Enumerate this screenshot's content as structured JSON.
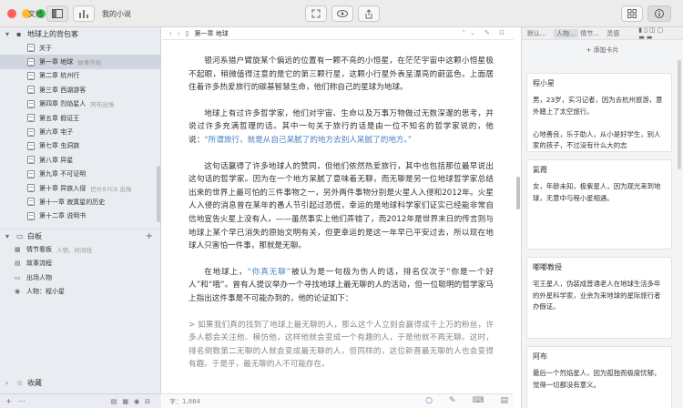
{
  "titlebar": {
    "sidebar_toggle_label": "文档",
    "project_name": "我的小说"
  },
  "sidebar": {
    "header": "地球上的背包客",
    "items": [
      {
        "label": "关于",
        "sub": ""
      },
      {
        "label": "第一章 地球",
        "sub": "故事开始"
      },
      {
        "label": "第二章 杭州行",
        "sub": ""
      },
      {
        "label": "第三章 西湖游客",
        "sub": ""
      },
      {
        "label": "第四章 烈焰星人",
        "sub": "阿布出场"
      },
      {
        "label": "第五章 假证王",
        "sub": ""
      },
      {
        "label": "第六章 宅子",
        "sub": ""
      },
      {
        "label": "第七章 虫洞族",
        "sub": ""
      },
      {
        "label": "第八章 异星",
        "sub": ""
      },
      {
        "label": "第九章 不可证明",
        "sub": ""
      },
      {
        "label": "第十章 异族入侵",
        "sub": "巴什97C6 出场"
      },
      {
        "label": "第十一章 寂寞星的历史",
        "sub": ""
      },
      {
        "label": "第十二章 说明书",
        "sub": ""
      }
    ],
    "board": {
      "header": "白板",
      "items": [
        {
          "label": "情节看板",
          "sub": "人物、时间线"
        },
        {
          "label": "故事流程",
          "sub": ""
        },
        {
          "label": "出场人物",
          "sub": ""
        },
        {
          "label": "人物：程小星",
          "sub": ""
        }
      ]
    },
    "favorites": "收藏"
  },
  "editor": {
    "title": "第一章 地球",
    "paragraphs": [
      {
        "pre": "银河系猎户臂旋某个偏远的位置有一颗不亮的小恒星，在茫茫宇宙中这颗小恒星极不起眼，稍微值得注意的是它的第三颗行星，这颗小行星外表呈漂亮的蔚蓝色，上面居住着许多热爱旅行的碳基智慧生命，他们称自己的星球为地球。",
        "hl": "",
        "post": ""
      },
      {
        "pre": "地球上有过许多哲学家，他们对宇宙、生命以及万事万物做过无数深邃的思考，并说过许多充满哲理的话。其中一句关于旅行的话是由一位不知名的哲学家说的，他说：",
        "hl": "“所谓旅行，就是从自己呆腻了的地方去别人呆腻了的地方。”",
        "post": ""
      },
      {
        "pre": "这句话赢得了许多地球人的赞同，但他们依然热爱旅行，其中也包括那位最早说出这句话的哲学家。因为在一个地方呆腻了意味着无聊，而无聊是另一位地球哲学家总结出来的世界上最可怕的三件事物之一，另外两件事物分别是火星人入侵和2012年。火星人入侵的消息曾在某年的愚人节引起过恐慌，幸运的是地球科学家们证实已经能非常自信地宣告火星上没有人，——虽然事实上他们弄错了，而2012年是世界末日的传言则与地球上某个早已消失的原始文明有关，但更幸运的是这一年早已平安过去，所以现在地球人只害怕一件事，那就是无聊。",
        "hl": "",
        "post": ""
      },
      {
        "pre": "在地球上，",
        "hl": "“你真无聊”",
        "post": "被认为是一句极为伤人的话，排名仅次于“你是一个好人”和“哦”。曾有人提议举办一个寻找地球上最无聊的人的活动，但一位聪明的哲学家马上指出这件事是不可能办到的，他的论证如下："
      }
    ],
    "quote": "> 如果我们真的找到了地球上最无聊的人，那么这个人立刻会赢得成千上万的粉丝，许多人都会关注他、模仿他，这样他就会变成一个有趣的人，于是他就不再无聊。这时，排名倒数第二无聊的人就会变成最无聊的人，但同样的，这位新晋最无聊的人也会变得有趣。于是乎，最无聊的人不可能存在。",
    "word_count": "字：1,884"
  },
  "rpanel": {
    "tabs": [
      "默认...",
      "人物...",
      "情节...",
      "灵感"
    ],
    "add_card": "+ 添加卡片",
    "cards": [
      {
        "title": "程小星",
        "body": "男，23岁，实习记者，因为去杭州旅游，意外踏上了太空旅行。\n\n心地善良，乐于助人，从小是好学生，别人家的孩子，不过没有什么大的志"
      },
      {
        "title": "氦霞",
        "body": "女，年龄未知，极紫星人，因为观光来到地球，无意中与程小星相遇。"
      },
      {
        "title": "嘟嘟教授",
        "body": "宅王星人，伪装成普通老人在地球生活多年的外星科学家，业余为来地球的星际旅行者办假证。"
      },
      {
        "title": "阿布",
        "body": "最后一个烈焰星人，因为孤独而极度忧郁，觉得一切都没有意义。"
      }
    ]
  }
}
